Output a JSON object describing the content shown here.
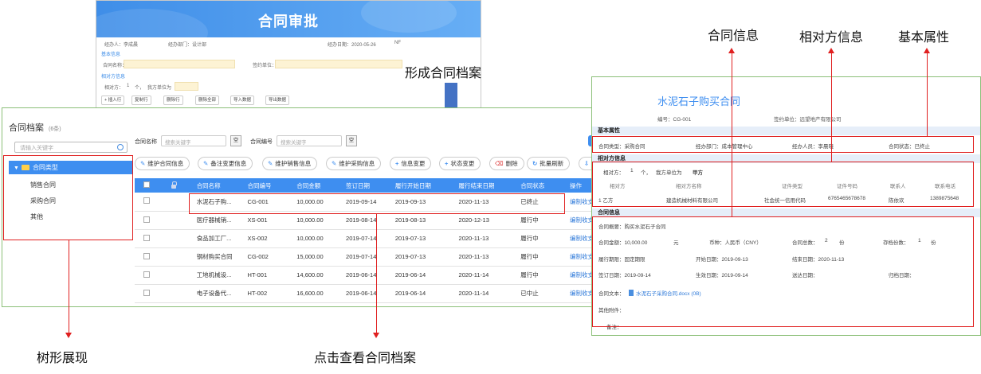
{
  "approval": {
    "title": "合同审批",
    "handler_label": "经办人：李成晨",
    "dept_label": "经办部门：设计部",
    "date_label": "经办日期：2020-05-26",
    "tail": "NF",
    "section_basic": "基本信息",
    "name_label": "合同名称：",
    "party_label": "签约单位：",
    "section_counter": "相对方信息",
    "counter_label": "相对方：",
    "counter_count": "1",
    "counter_unit": "个，",
    "role_label": "我方单位为",
    "buttons": [
      "+ 插入行",
      "复制行",
      "删除行",
      "删除全部",
      "导入数据",
      "导出数据"
    ]
  },
  "arrow_label": "形成合同档案",
  "archive": {
    "title": "合同档案",
    "count": "(6条)",
    "tree_search_placeholder": "请输入关键字",
    "tree_root": "合同类型",
    "tree_children": [
      "销售合同",
      "采购合同",
      "其他"
    ],
    "filter_name_label": "合同名称",
    "filter_name_placeholder": "搜索关键字",
    "filter_no_label": "合同编号",
    "filter_no_placeholder": "搜索关键字",
    "filter_clear": "空",
    "toolbar": [
      "维护合同信息",
      "备注变更信息",
      "维护销售信息",
      "维护采购信息",
      "信息变更",
      "状态变更",
      "删除",
      "批量刷新"
    ],
    "columns": [
      "合同名称",
      "合同编号",
      "合同金额",
      "签订日期",
      "履行开始日期",
      "履行结束日期",
      "合同状态",
      "操作"
    ],
    "rows": [
      [
        "水泥石子购...",
        "CG-001",
        "10,000.00",
        "2019-09-14",
        "2019-09-13",
        "2020-11-13",
        "已终止",
        "编制收支"
      ],
      [
        "医疗器械销...",
        "XS-001",
        "10,000.00",
        "2019-08-14",
        "2019-08-13",
        "2020-12-13",
        "履行中",
        "编制收支"
      ],
      [
        "食品加工厂...",
        "XS-002",
        "10,000.00",
        "2019-07-14",
        "2019-07-13",
        "2020-11-13",
        "履行中",
        "编制收支"
      ],
      [
        "钢材购买合同",
        "CG-002",
        "15,000.00",
        "2019-07-14",
        "2019-07-13",
        "2020-11-13",
        "履行中",
        "编制收支"
      ],
      [
        "工地机械设...",
        "HT-001",
        "14,600.00",
        "2019-06-14",
        "2019-06-14",
        "2020-11-14",
        "履行中",
        "编制收支"
      ],
      [
        "电子设备代...",
        "HT-002",
        "16,600.00",
        "2019-06-14",
        "2019-06-14",
        "2020-11-14",
        "已中止",
        "编制收支"
      ]
    ]
  },
  "detail": {
    "title": "水泥石子购买合同",
    "no_label": "编号：CG-001",
    "party_label": "签约单位：远望地产有限公司",
    "sec_basic": "基本属性",
    "basic": [
      "合同类型：采购合同",
      "经办部门：成本管理中心",
      "经办人员：李晨晓",
      "合同状态：已终止"
    ],
    "sec_counter": "相对方信息",
    "counter_label": "相对方：",
    "counter_count": "1",
    "counter_unit": "个，",
    "role_label": "我方单位为",
    "role_value": "甲方",
    "counter_columns": [
      "相对方",
      "相对方名称",
      "证件类型",
      "证件号码",
      "联系人",
      "联系电话"
    ],
    "counter_row": [
      "1   乙方",
      "建造机械材料有限公司",
      "社会统一信用代码",
      "6765465678678",
      "陈依欢",
      "1389875648"
    ],
    "sec_contract": "合同信息",
    "summary": "合同概要：购买水泥石子合同",
    "amount": "合同金额：10,000.00",
    "amount_unit": "元",
    "currency": "币种：人民币（CNY）",
    "copies": "合同总数：",
    "copies_val": "2",
    "copies_unit": "份",
    "stored": "存档份数：",
    "stored_val": "1",
    "stored_unit": "份",
    "period": "履行期限：固定期限",
    "start": "开始日期：2019-09-13",
    "end": "结束日期：2020-11-13",
    "sign": "签订日期：2019-09-14",
    "effective": "生效日期：2019-09-14",
    "send": "送达日期：",
    "archive_date": "归档日期：",
    "text_label": "合同文本：",
    "text_file": "水泥石子采购合同.docx (0B)",
    "attach": "其他附件：",
    "remark": "备注："
  },
  "annotations": {
    "contract_info": "合同信息",
    "counterparty_info": "相对方信息",
    "basic_attr": "基本属性",
    "tree_view": "树形展现",
    "click_view": "点击查看合同档案"
  },
  "colors": {
    "accent": "#3e8ef0",
    "annotation": "#e02020",
    "frame": "#8bbf78"
  }
}
